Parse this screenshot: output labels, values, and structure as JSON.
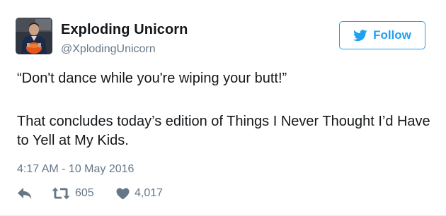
{
  "author": {
    "name": "Exploding Unicorn",
    "handle": "@XplodingUnicorn"
  },
  "follow_button": {
    "label": "Follow"
  },
  "tweet": {
    "line1": "“Don't dance while you're wiping your butt!”",
    "line2": "That concludes today’s edition of Things I Never Thought I’d Have to Yell at My Kids.",
    "timestamp": "4:17 AM - 10 May 2016"
  },
  "actions": {
    "retweets": "605",
    "likes": "4,017"
  },
  "icons": {
    "reply": "reply-icon",
    "retweet": "retweet-icon",
    "like": "heart-icon",
    "follow": "twitter-bird-icon"
  },
  "colors": {
    "accent": "#1da1f2",
    "text": "#14171a",
    "muted": "#657786"
  }
}
